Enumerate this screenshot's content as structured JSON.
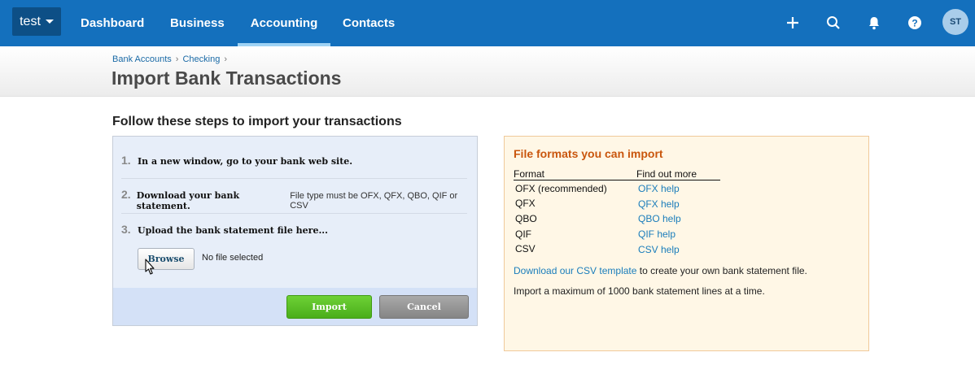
{
  "nav": {
    "org_label": "test",
    "items": [
      {
        "label": "Dashboard"
      },
      {
        "label": "Business"
      },
      {
        "label": "Accounting"
      },
      {
        "label": "Contacts"
      }
    ],
    "avatar_initials": "ST",
    "icons": [
      "plus-icon",
      "search-icon",
      "bell-icon",
      "help-icon"
    ]
  },
  "breadcrumb": {
    "items": [
      "Bank Accounts",
      "Checking"
    ],
    "separator": "›"
  },
  "page_title": "Import Bank Transactions",
  "steps": {
    "heading": "Follow these steps to import your transactions",
    "items": [
      {
        "number": "1.",
        "bold": "In a new window, go to your bank web site.",
        "rest": ""
      },
      {
        "number": "2.",
        "bold": "Download your bank statement.",
        "rest": "File type must be OFX, QFX, QBO, QIF or CSV"
      },
      {
        "number": "3.",
        "bold": "Upload the bank statement file here...",
        "rest": ""
      }
    ],
    "browse_label": "Browse",
    "file_status": "No file selected",
    "import_label": "Import",
    "cancel_label": "Cancel"
  },
  "formats": {
    "heading": "File formats you can import",
    "col_format": "Format",
    "col_help": "Find out more",
    "rows": [
      {
        "format": "OFX (recommended)",
        "help": "OFX help"
      },
      {
        "format": "QFX",
        "help": "QFX help"
      },
      {
        "format": "QBO",
        "help": "QBO help"
      },
      {
        "format": "QIF",
        "help": "QIF help"
      },
      {
        "format": "CSV",
        "help": "CSV help"
      }
    ],
    "csv_link": "Download our CSV template",
    "csv_rest": " to create your own bank statement file.",
    "max_note": "Import a maximum of 1000 bank statement lines at a time."
  },
  "colors": {
    "nav_bg": "#1470bd",
    "accent_heading": "#c9560d",
    "link": "#1a7dbb",
    "import_button": "#4aae1a"
  }
}
